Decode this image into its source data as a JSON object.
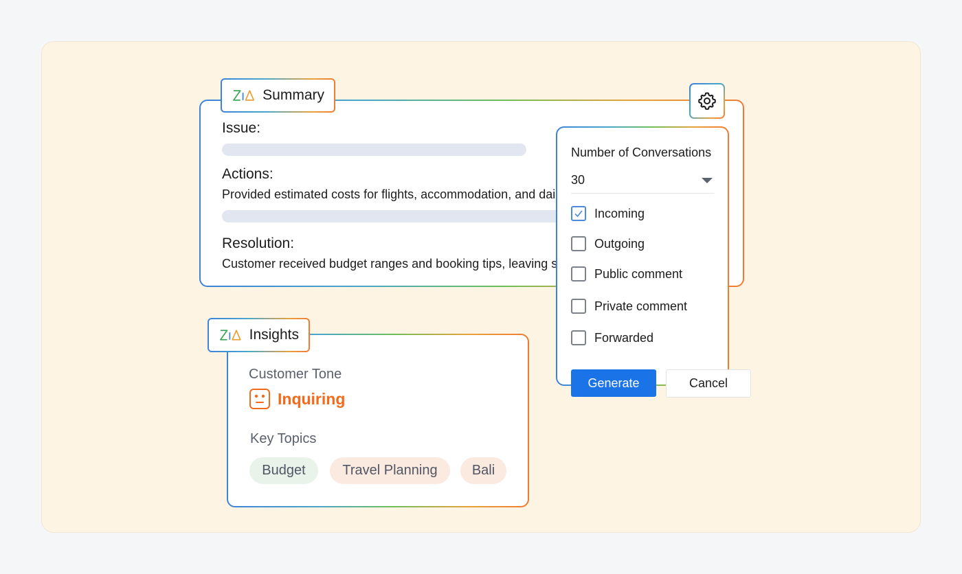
{
  "summary": {
    "tag_label": "Summary",
    "issue_label": "Issue:",
    "actions_label": "Actions:",
    "actions_text": "Provided estimated costs for flights, accommodation, and dail",
    "resolution_label": "Resolution:",
    "resolution_text": "Customer received budget ranges and booking tips, leaving sa"
  },
  "settings": {
    "title": "Number of Conversations",
    "selected_value": "30",
    "options": [
      {
        "label": "Incoming",
        "checked": true
      },
      {
        "label": "Outgoing",
        "checked": false
      },
      {
        "label": "Public comment",
        "checked": false
      },
      {
        "label": "Private comment",
        "checked": false
      },
      {
        "label": "Forwarded",
        "checked": false
      }
    ],
    "generate_label": "Generate",
    "cancel_label": "Cancel"
  },
  "insights": {
    "tag_label": "Insights",
    "tone_label": "Customer Tone",
    "tone_value": "Inquiring",
    "topics_label": "Key Topics",
    "topics": [
      "Budget",
      "Travel Planning",
      "Bali"
    ]
  },
  "colors": {
    "accent": "#1b73e8",
    "tone": "#f26a1b",
    "chip_green": "#e9f3ea",
    "chip_peach": "#fbeadf",
    "background": "#fef4e4"
  },
  "icons": {
    "brand": "zia-logo-icon",
    "settings": "gear-icon",
    "tone": "face-icon",
    "dropdown": "caret-down-icon",
    "check": "checkmark-icon"
  }
}
